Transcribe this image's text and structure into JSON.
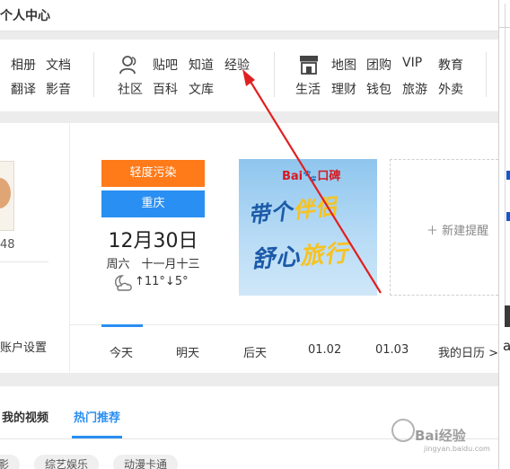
{
  "header": {
    "title": "个人中心"
  },
  "nav": {
    "group1": [
      "相册",
      "文档",
      "翻译",
      "影音"
    ],
    "group2": [
      "贴吧",
      "知道",
      "经验",
      "社区",
      "百科",
      "文库"
    ],
    "group3": [
      "地图",
      "团购",
      "VIP",
      "教育",
      "生活",
      "理财",
      "钱包",
      "旅游",
      "外卖"
    ]
  },
  "left": {
    "count": "48",
    "account_settings": "账户设置"
  },
  "weather": {
    "air_quality": "轻度污染",
    "city": "重庆",
    "date": "12月30日",
    "lunar": "周六　十一月十三",
    "temp": "↑11°↓5°"
  },
  "poster": {
    "brand": "Bai",
    "brand2": "口碑",
    "line1": "带个",
    "line1b": "伴侣",
    "line2": "舒心",
    "line2b": "旅行"
  },
  "reminder": {
    "label": "新建提醒"
  },
  "tabs": [
    "今天",
    "明天",
    "后天",
    "01.02",
    "01.03",
    "我的日历 >"
  ],
  "bottom": {
    "tab_my_video": "我的视频",
    "tab_hot": "热门推荐",
    "pills": [
      "影",
      "综艺娱乐",
      "动漫卡通"
    ]
  },
  "watermark": {
    "text": "Bai经验",
    "sub": "jingyan.baidu.com"
  },
  "sidebar": {
    "char": "a"
  },
  "colors": {
    "accent": "#2a8ff2",
    "orange": "#ff7a19",
    "arrow": "#e02020"
  }
}
